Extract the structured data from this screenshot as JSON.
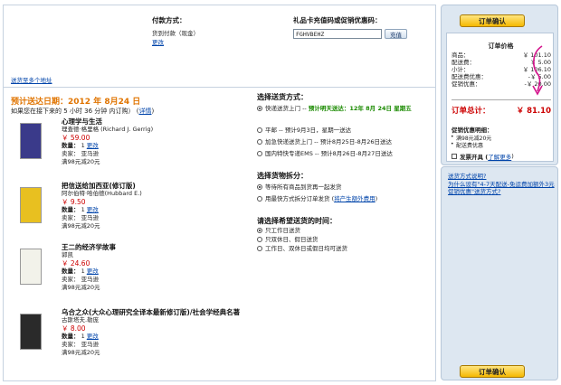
{
  "payment": {
    "title": "付款方式：",
    "value": "货到付款（现金）",
    "change": "更改"
  },
  "gift_card": {
    "title": "礼品卡充值码或促销优惠码：",
    "value": "FGHVBEHZ",
    "button": "充值"
  },
  "ship_multi_link": "送货至多个地址",
  "estimate": {
    "date": "预计送达日期：2012 年 8月24 日",
    "countdown": "如果您在接下来的 5 小时 36 分钟 内订购）",
    "countdown_link": "详情"
  },
  "item_labels": {
    "qty_label": "数量：",
    "change": "更改",
    "seller_label": "卖家：",
    "seller": "亚马逊"
  },
  "items": [
    {
      "title": "心理学与生活",
      "author": "理查德·格里格 (Richard J. Gerrig)",
      "price": "￥ 59.00",
      "qty": "1",
      "promo": "满98元减20元",
      "cover_color": "#3a3a8a"
    },
    {
      "title": "把信送给加西亚(修订版)",
      "author": "阿尔伯特·哈伯德(Hubbard E.)",
      "price": "￥ 9.50",
      "qty": "1",
      "promo": "满98元减20元",
      "cover_color": "#e8c020"
    },
    {
      "title": "王二的经济学故事",
      "author": "郭凯",
      "price": "￥ 24.60",
      "qty": "1",
      "promo": "满98元减20元",
      "cover_color": "#f2f2ea"
    },
    {
      "title": "乌合之众(大众心理研究全译本最新修订版)/社会学经典名著",
      "author": "古斯塔夫.勒庞",
      "price": "￥ 8.00",
      "qty": "1",
      "promo": "满98元减20元",
      "cover_color": "#2a2a2a"
    }
  ],
  "shipping": {
    "title": "选择送货方式：",
    "options": [
      {
        "label": "快递送货上门 --",
        "extra": "预计明天送达：12年 8月 24日 星期五",
        "selected": true
      },
      {
        "label": "平邮  --  预计9月3日，星期一送达",
        "extra": "",
        "selected": false
      },
      {
        "label": "加急快递送货上门 --  预计8月25日-8月26日送达",
        "extra": "",
        "selected": false
      },
      {
        "label": "国内特快专递EMS --  预计8月26日-8月27日送达",
        "extra": "",
        "selected": false
      }
    ]
  },
  "split": {
    "title": "选择货物拆分：",
    "options": [
      {
        "label": "等待所有商品到货再一起发货",
        "link": "",
        "selected": true
      },
      {
        "label": "用最快方式拆分订单发货 (",
        "link": "将产生额外费用",
        "tail": ")",
        "selected": false
      }
    ]
  },
  "time": {
    "title": "请选择希望送货的时间：",
    "options": [
      {
        "label": "只工作日送货",
        "selected": true
      },
      {
        "label": "只双休日、假日送货",
        "selected": false
      },
      {
        "label": "工作日、双休日或假日均可送货",
        "selected": false
      }
    ]
  },
  "summary": {
    "order_button": "订单确认",
    "price_title": "订单价格",
    "rows": [
      {
        "label": "商品：",
        "amount": "￥ 101.10"
      },
      {
        "label": "配送费：",
        "amount": "￥ 5.00"
      },
      {
        "label": "小计：",
        "amount": "￥ 106.10"
      },
      {
        "label": "配送费优惠：",
        "amount": "-￥ 5.00"
      },
      {
        "label": "促销优惠：",
        "amount": "-￥ 20.00"
      }
    ],
    "total_label": "订单总计：",
    "total_amount": "￥ 81.10",
    "promo_title": "促销优惠明细：",
    "promos": [
      "满98元减20元",
      "配送费优惠"
    ],
    "invoice_label": "发票开具 (",
    "invoice_link": "了解更多",
    "invoice_tail": ")"
  },
  "help": {
    "title": "送货方式说明?",
    "link": "为什么设有\"4-7天配送-免运费加额外3元促销优惠\"送货方式?",
    "order_button": "订单确认"
  },
  "colors": {
    "accent_orange": "#e07400",
    "price_red": "#cc0000",
    "arrow_magenta": "#d4148c",
    "sidebar_bg": "#dde7f1"
  }
}
